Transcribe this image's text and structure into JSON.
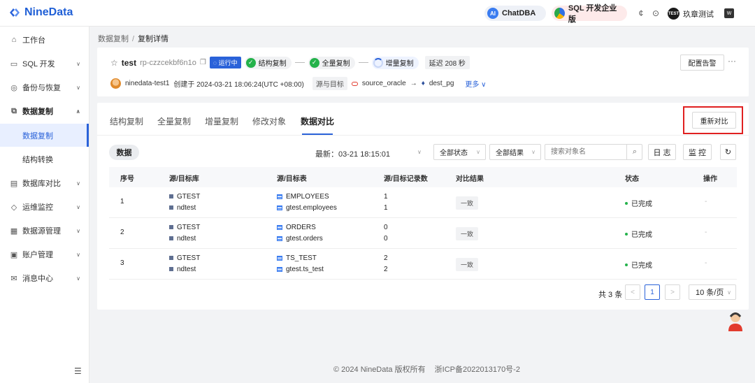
{
  "brand": {
    "name": "NineData"
  },
  "topbar": {
    "chatdba_label": "ChatDBA",
    "sql_label": "SQL 开发企业版",
    "username": "玖章测试",
    "avatar_text": "TEST"
  },
  "sidebar": {
    "items": [
      {
        "label": "工作台",
        "icon": "home-icon"
      },
      {
        "label": "SQL 开发",
        "icon": "monitor-icon"
      },
      {
        "label": "备份与恢复",
        "icon": "backup-icon"
      },
      {
        "label": "数据复制",
        "icon": "replicate-icon"
      },
      {
        "label": "数据库对比",
        "icon": "compare-icon"
      },
      {
        "label": "运维监控",
        "icon": "ops-icon"
      },
      {
        "label": "数据源管理",
        "icon": "datasource-icon"
      },
      {
        "label": "账户管理",
        "icon": "account-icon"
      },
      {
        "label": "消息中心",
        "icon": "message-icon"
      }
    ],
    "sub_items": [
      {
        "label": "数据复制"
      },
      {
        "label": "结构转换"
      }
    ]
  },
  "breadcrumb": {
    "parent": "数据复制",
    "separator": "/",
    "current": "复制详情"
  },
  "task": {
    "name": "test",
    "id": "rp-czzcekbf6n1o",
    "status": "运行中",
    "steps": [
      "结构复制",
      "全量复制",
      "增量复制"
    ],
    "delay_label": "延迟",
    "delay_value": "208 秒",
    "creator": "ninedata-test1",
    "created_text": "创建于 2024-03-21 18:06:24(UTC +08:00)",
    "src_dst_label": "源与目标",
    "source": "source_oracle",
    "arrow": "→",
    "target": "dest_pg",
    "more_label": "更多 ∨",
    "alert_button": "配置告警",
    "ellipsis": "···"
  },
  "tabs": [
    "结构复制",
    "全量复制",
    "增量复制",
    "修改对象",
    "数据对比"
  ],
  "recompare_button": "重新对比",
  "toolbar": {
    "data_tag": "数据",
    "latest": "最新：03-21 18:15:01",
    "status_select": "全部状态",
    "result_select": "全部结果",
    "search_placeholder": "搜索对象名",
    "log_button": "日 志",
    "monitor_button": "监 控"
  },
  "table": {
    "headers": [
      "序号",
      "源/目标库",
      "源/目标表",
      "源/目标记录数",
      "对比结果",
      "状态",
      "操作"
    ],
    "rows": [
      {
        "no": "1",
        "src_db": "GTEST",
        "dst_db": "ndtest",
        "src_tbl": "EMPLOYEES",
        "dst_tbl": "gtest.employees",
        "src_cnt": "1",
        "dst_cnt": "1",
        "result": "一致",
        "status": "已完成",
        "op": "-"
      },
      {
        "no": "2",
        "src_db": "GTEST",
        "dst_db": "ndtest",
        "src_tbl": "ORDERS",
        "dst_tbl": "gtest.orders",
        "src_cnt": "0",
        "dst_cnt": "0",
        "result": "一致",
        "status": "已完成",
        "op": "-"
      },
      {
        "no": "3",
        "src_db": "GTEST",
        "dst_db": "ndtest",
        "src_tbl": "TS_TEST",
        "dst_tbl": "gtest.ts_test",
        "src_cnt": "2",
        "dst_cnt": "2",
        "result": "一致",
        "status": "已完成",
        "op": "-"
      }
    ]
  },
  "pagination": {
    "total": "共 3 条",
    "current_page": "1",
    "prev": "<",
    "next": ">",
    "page_size": "10 条/页"
  },
  "footer": {
    "copyright": "© 2024 NineData 版权所有",
    "icp": "浙ICP备2022013170号-2"
  },
  "colors": {
    "accent": "#2a62d9",
    "success": "#24b24b",
    "highlight_box": "#e02020"
  }
}
